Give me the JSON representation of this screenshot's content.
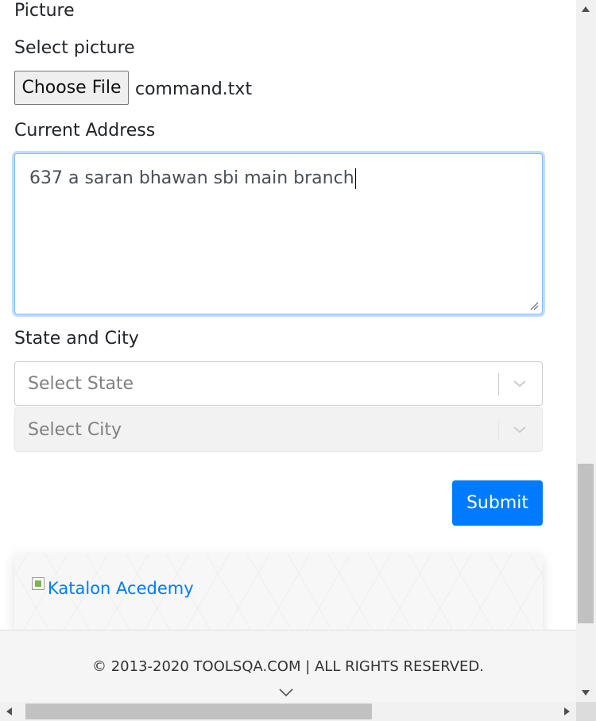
{
  "form": {
    "picture_label": "Picture",
    "select_picture_label": "Select picture",
    "choose_file_label": "Choose File",
    "file_name": "command.txt",
    "current_address_label": "Current Address",
    "current_address_value": "637 a saran bhawan sbi main branch",
    "state_city_label": "State and City",
    "state_placeholder": "Select State",
    "city_placeholder": "Select City",
    "submit_label": "Submit"
  },
  "banner": {
    "link_text": "Katalon Acedemy"
  },
  "footer": {
    "copyright": "© 2013-2020 TOOLSQA.COM | ALL RIGHTS RESERVED."
  },
  "colors": {
    "primary": "#007bff",
    "focus_border": "#80bdff"
  },
  "icons": [
    "chevron-down-icon",
    "resize-handle-icon",
    "broken-image-icon",
    "scroll-down-icon"
  ]
}
